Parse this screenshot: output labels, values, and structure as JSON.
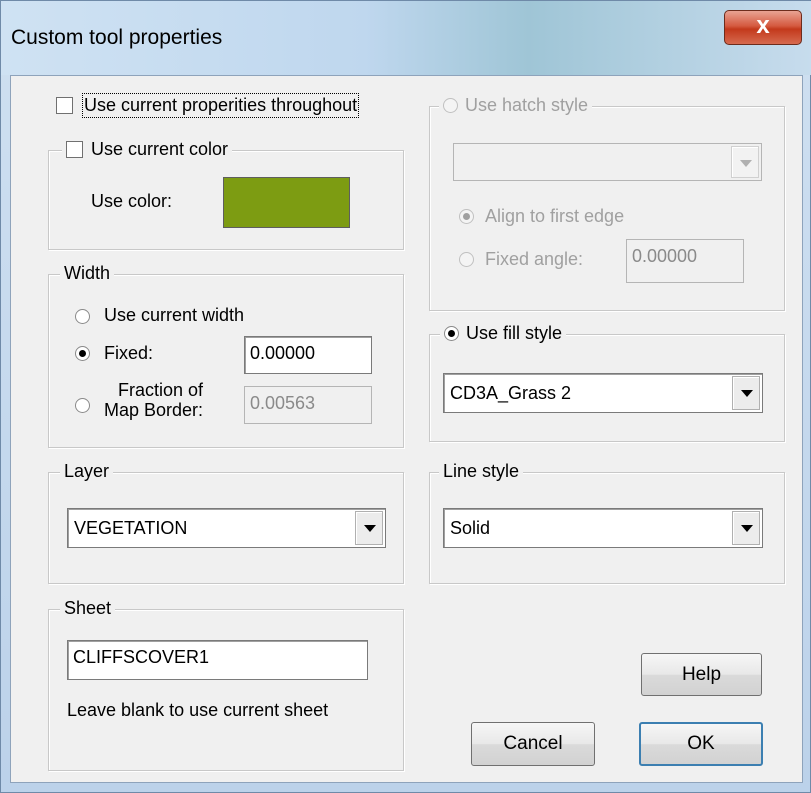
{
  "window": {
    "title": "Custom tool properties",
    "close_glyph": "x"
  },
  "use_current_props": {
    "label": "Use current properities throughout",
    "checked": false
  },
  "color_group": {
    "label": "Use current color",
    "checked": false,
    "use_color_label": "Use color:",
    "swatch_color": "#7d9c12"
  },
  "width_group": {
    "label": "Width",
    "options": [
      {
        "label": "Use current width",
        "selected": false
      },
      {
        "label": "Fixed:",
        "selected": true
      },
      {
        "label_line1": "Fraction of",
        "label_line2": "Map Border:",
        "selected": false
      }
    ],
    "fixed_value": "0.00000",
    "fraction_value": "0.00563"
  },
  "layer_group": {
    "label": "Layer",
    "value": "VEGETATION"
  },
  "sheet_group": {
    "label": "Sheet",
    "value": "CLIFFSCOVER1",
    "hint": "Leave blank to use current sheet"
  },
  "hatch_group": {
    "label": "Use hatch style",
    "selected": false,
    "value": "",
    "align_label": "Align to first edge",
    "fixed_angle_label": "Fixed angle:",
    "fixed_angle_value": "0.00000"
  },
  "fill_group": {
    "label": "Use fill style",
    "selected": true,
    "value": "CD3A_Grass 2"
  },
  "line_group": {
    "label": "Line style",
    "value": "Solid"
  },
  "buttons": {
    "help": "Help",
    "cancel": "Cancel",
    "ok": "OK"
  }
}
